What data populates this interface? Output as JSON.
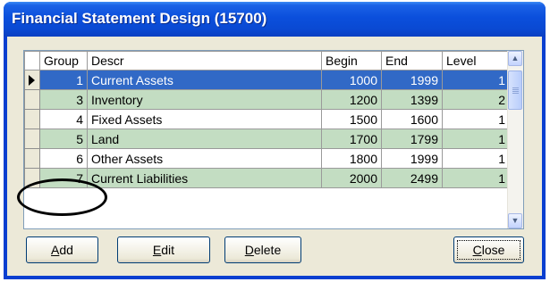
{
  "window": {
    "title": "Financial Statement Design (15700)"
  },
  "grid": {
    "columns": [
      "Group",
      "Descr",
      "Begin",
      "End",
      "Level"
    ],
    "rows": [
      {
        "group": "1",
        "descr": "Current Assets",
        "begin": "1000",
        "end": "1999",
        "level": "1",
        "selected": true
      },
      {
        "group": "3",
        "descr": "Inventory",
        "begin": "1200",
        "end": "1399",
        "level": "2"
      },
      {
        "group": "4",
        "descr": "Fixed Assets",
        "begin": "1500",
        "end": "1600",
        "level": "1"
      },
      {
        "group": "5",
        "descr": "Land",
        "begin": "1700",
        "end": "1799",
        "level": "1"
      },
      {
        "group": "6",
        "descr": "Other Assets",
        "begin": "1800",
        "end": "1999",
        "level": "1"
      },
      {
        "group": "7",
        "descr": "Current Liabilities",
        "begin": "2000",
        "end": "2499",
        "level": "1"
      }
    ]
  },
  "buttons": {
    "add": {
      "mnemonic": "A",
      "rest": "dd"
    },
    "edit": {
      "mnemonic": "E",
      "rest": "dit"
    },
    "delete": {
      "mnemonic": "D",
      "rest": "elete"
    },
    "close": {
      "mnemonic": "C",
      "rest": "lose"
    }
  },
  "colors": {
    "selected_row": "#3169c6",
    "alt_row": "#c3ddc2",
    "title_bar": "#0a49d2",
    "annotation": "#000000"
  }
}
